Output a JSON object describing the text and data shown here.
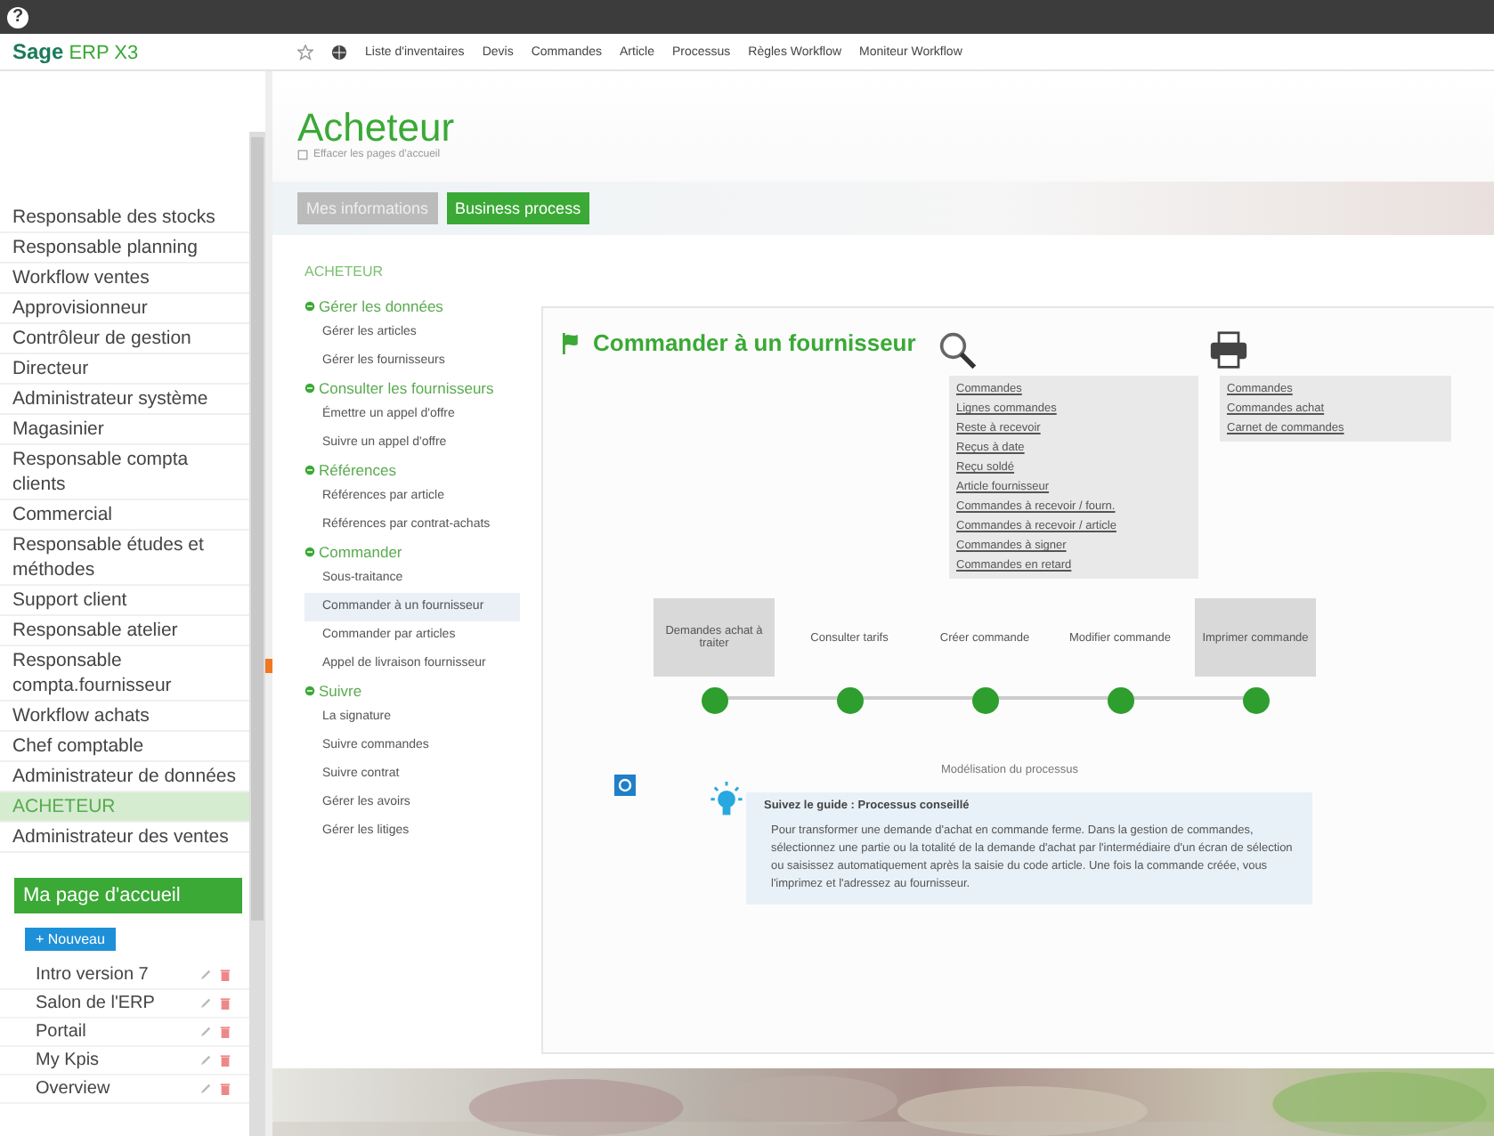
{
  "topbar": {
    "help": "?"
  },
  "header": {
    "logo_main": "Sage",
    "logo_sub": "ERP X3",
    "menu": [
      "Liste d'inventaires",
      "Devis",
      "Commandes",
      "Article",
      "Processus",
      "Règles Workflow",
      "Moniteur Workflow"
    ]
  },
  "sidebar": {
    "roles": [
      {
        "label": "Responsable des stocks",
        "selected": false
      },
      {
        "label": "Responsable planning",
        "selected": false
      },
      {
        "label": "Workflow ventes",
        "selected": false
      },
      {
        "label": "Approvisionneur",
        "selected": false
      },
      {
        "label": "Contrôleur de gestion",
        "selected": false
      },
      {
        "label": "Directeur",
        "selected": false
      },
      {
        "label": "Administrateur système",
        "selected": false
      },
      {
        "label": "Magasinier",
        "selected": false
      },
      {
        "label": "Responsable compta clients",
        "selected": false
      },
      {
        "label": "Commercial",
        "selected": false
      },
      {
        "label": "Responsable études et méthodes",
        "selected": false
      },
      {
        "label": "Support client",
        "selected": false
      },
      {
        "label": "Responsable atelier",
        "selected": false
      },
      {
        "label": "Responsable compta.fournisseur",
        "selected": false
      },
      {
        "label": "Workflow achats",
        "selected": false
      },
      {
        "label": "Chef comptable",
        "selected": false
      },
      {
        "label": "Administrateur de données",
        "selected": false
      },
      {
        "label": "ACHETEUR",
        "selected": true
      },
      {
        "label": "Administrateur des ventes",
        "selected": false
      }
    ],
    "home_title": "Ma page d'accueil",
    "new_button": "+ Nouveau",
    "pages": [
      "Intro version 7",
      "Salon de l'ERP",
      "Portail",
      "My Kpis",
      "Overview"
    ]
  },
  "page": {
    "title": "Acheteur",
    "subtitle": "Effacer les pages d'accueil",
    "tabs": [
      {
        "label": "Mes informations",
        "selected": false
      },
      {
        "label": "Business process",
        "selected": true
      }
    ]
  },
  "nav": {
    "heading": "ACHETEUR",
    "groups": [
      {
        "label": "Gérer les données",
        "items": [
          {
            "label": "Gérer les articles",
            "selected": false
          },
          {
            "label": "Gérer les fournisseurs",
            "selected": false
          }
        ]
      },
      {
        "label": "Consulter les fournisseurs",
        "items": [
          {
            "label": "Émettre un appel d'offre",
            "selected": false
          },
          {
            "label": "Suivre un appel d'offre",
            "selected": false
          }
        ]
      },
      {
        "label": "Références",
        "items": [
          {
            "label": "Références par article",
            "selected": false
          },
          {
            "label": "Références par contrat-achats",
            "selected": false
          }
        ]
      },
      {
        "label": "Commander",
        "items": [
          {
            "label": "Sous-traitance",
            "selected": false
          },
          {
            "label": "Commander à un fournisseur",
            "selected": true
          },
          {
            "label": "Commander par articles",
            "selected": false
          },
          {
            "label": "Appel de livraison fournisseur",
            "selected": false
          }
        ]
      },
      {
        "label": "Suivre",
        "items": [
          {
            "label": "La signature",
            "selected": false
          },
          {
            "label": "Suivre commandes",
            "selected": false
          },
          {
            "label": "Suivre contrat",
            "selected": false
          },
          {
            "label": "Gérer les avoirs",
            "selected": false
          },
          {
            "label": "Gérer les litiges",
            "selected": false
          }
        ]
      }
    ]
  },
  "process": {
    "title": "Commander à un fournisseur",
    "steps": [
      {
        "label": "Demandes achat à traiter",
        "boxed": true
      },
      {
        "label": "Consulter tarifs",
        "boxed": false
      },
      {
        "label": "Créer commande",
        "boxed": false,
        "tool": {
          "kind": "search",
          "links": [
            "Commandes",
            "Lignes commandes",
            "Reste à recevoir",
            "Reçus à date",
            "Reçu soldé",
            "Article fournisseur",
            "Commandes à recevoir / fourn.",
            "Commandes à recevoir / article",
            "Commandes à signer",
            "Commandes en retard"
          ]
        }
      },
      {
        "label": "Modifier commande",
        "boxed": false
      },
      {
        "label": "Imprimer commande",
        "boxed": true,
        "tool": {
          "kind": "print",
          "links": [
            "Commandes",
            "Commandes achat",
            "Carnet de commandes"
          ]
        }
      }
    ],
    "modeling": "Modélisation du processus",
    "guide_title": "Suivez le guide : Processus conseillé",
    "guide_text": "Pour transformer une demande d'achat en commande ferme. Dans la gestion de commandes, sélectionnez une partie ou la totalité de la demande d'achat par l'intermédiaire d'un écran de sélection ou saisissez automatiquement après la saisie du code article. Une fois la commande créée, vous l'imprimez et l'adressez au fournisseur."
  }
}
